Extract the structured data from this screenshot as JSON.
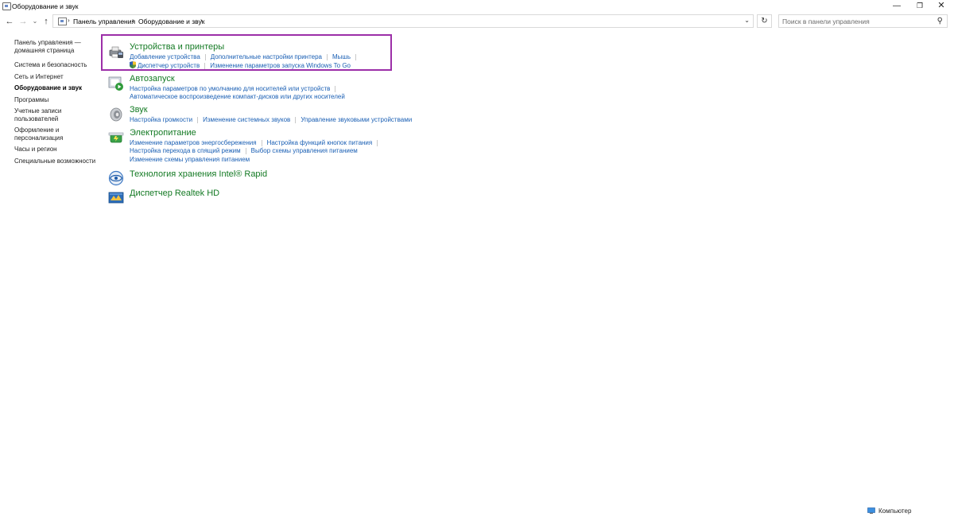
{
  "window": {
    "title": "Оборудование и звук",
    "minimize": "—",
    "maximize": "❐",
    "close": "✕"
  },
  "nav": {
    "back": "←",
    "forward": "→",
    "recent": "⌄",
    "up": "↑",
    "breadcrumb": [
      "Панель управления",
      "Оборудование и звук"
    ],
    "separator": "›",
    "dropdown": "⌄",
    "refresh": "↻"
  },
  "search": {
    "placeholder": "Поиск в панели управления",
    "icon": "⚲"
  },
  "sidebar": {
    "items": [
      {
        "label": "Панель управления — домашняя страница"
      },
      {
        "label": "Система и безопасность"
      },
      {
        "label": "Сеть и Интернет"
      },
      {
        "label": "Оборудование и звук"
      },
      {
        "label": "Программы"
      },
      {
        "label": "Учетные записи пользователей"
      },
      {
        "label": "Оформление и персонализация"
      },
      {
        "label": "Часы и регион"
      },
      {
        "label": "Специальные возможности"
      }
    ]
  },
  "categories": {
    "devices": {
      "title": "Устройства и принтеры",
      "links": [
        "Добавление устройства",
        "Дополнительные настройки принтера",
        "Мышь",
        "Диспетчер устройств",
        "Изменение параметров запуска Windows To Go"
      ]
    },
    "autoplay": {
      "title": "Автозапуск",
      "links": [
        "Настройка параметров по умолчанию для носителей или устройств",
        "Автоматическое воспроизведение компакт-дисков или других носителей"
      ]
    },
    "sound": {
      "title": "Звук",
      "links": [
        "Настройка громкости",
        "Изменение системных звуков",
        "Управление звуковыми устройствами"
      ]
    },
    "power": {
      "title": "Электропитание",
      "links": [
        "Изменение параметров энергосбережения",
        "Настройка функций кнопок питания",
        "Настройка перехода в спящий режим",
        "Выбор схемы управления питанием",
        "Изменение схемы управления питанием"
      ]
    },
    "intel": {
      "title": "Технология хранения Intel® Rapid"
    },
    "realtek": {
      "title": "Диспетчер Realtek HD"
    }
  },
  "status": {
    "computer": "Компьютер"
  },
  "colors": {
    "category_title": "#147a24",
    "link": "#1a5fb4",
    "highlight_border": "#9c2fa8"
  }
}
